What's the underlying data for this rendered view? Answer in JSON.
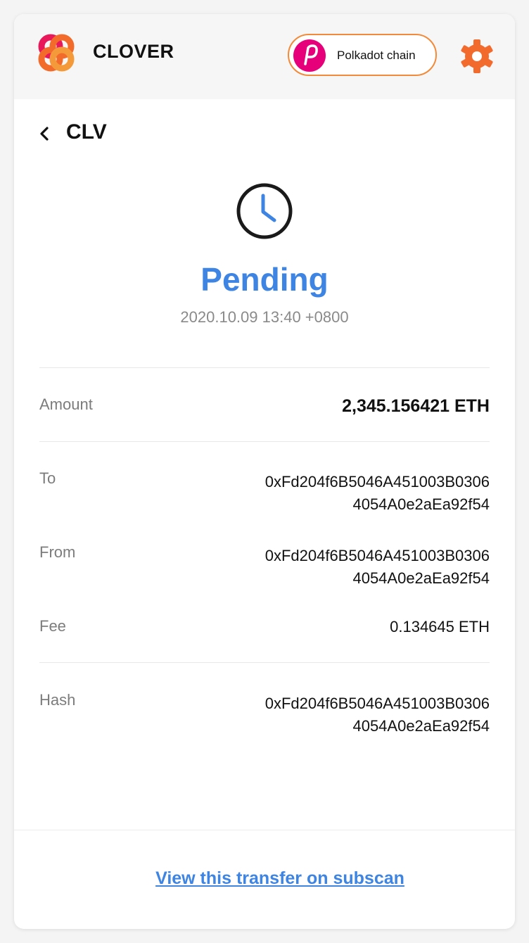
{
  "header": {
    "brand": "CLOVER",
    "chain_label": "Polkadot chain",
    "colors": {
      "accent": "#f28a3a",
      "chain": "#e6007a",
      "logo_primary": "#f26b2b",
      "logo_secondary": "#e8185a"
    }
  },
  "page": {
    "title": "CLV"
  },
  "status": {
    "label": "Pending",
    "timestamp": "2020.10.09 13:40 +0800",
    "icon": "clock-icon",
    "color": "#3d84e3"
  },
  "details": {
    "amount_label": "Amount",
    "amount_value": "2,345.156421 ETH",
    "to_label": "To",
    "to_line1": "0xFd204f6B5046A451003B0306",
    "to_line2": "4054A0e2aEa92f54",
    "from_label": "From",
    "from_line1": "0xFd204f6B5046A451003B0306",
    "from_line2": "4054A0e2aEa92f54",
    "fee_label": "Fee",
    "fee_value": "0.134645 ETH",
    "hash_label": "Hash",
    "hash_line1": "0xFd204f6B5046A451003B0306",
    "hash_line2": "4054A0e2aEa92f54"
  },
  "footer": {
    "link_text": "View this transfer on subscan"
  }
}
